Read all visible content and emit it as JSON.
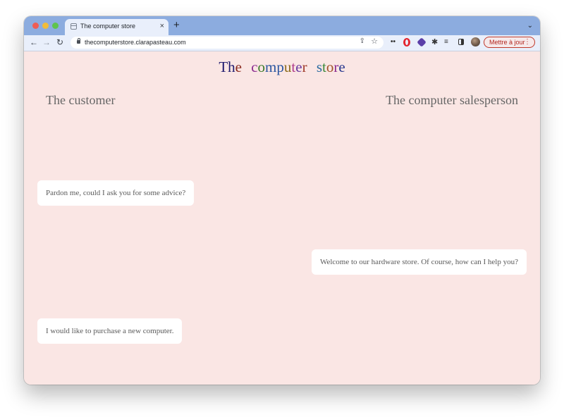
{
  "browser": {
    "tab": {
      "title": "The computer store",
      "close_glyph": "×"
    },
    "new_tab_glyph": "+",
    "tab_menu_glyph": "⌄",
    "address": {
      "url": "thecomputerstore.clarapasteau.com"
    },
    "update_button": {
      "label": "Mettre à jour",
      "menu_glyph": "⋮"
    },
    "icons": {
      "back": "arrow-left-icon",
      "forward": "arrow-right-icon",
      "reload": "reload-icon",
      "lock": "lock-icon",
      "share": "share-icon",
      "bookmark": "star-icon",
      "extensions": [
        "dots-extension-icon",
        "opera-icon",
        "cube-extension-icon",
        "puzzle-icon",
        "reading-list-icon",
        "side-panel-icon"
      ],
      "profile": "avatar"
    }
  },
  "page": {
    "title_words": [
      {
        "text": "The",
        "colors": [
          "#1f1a6e",
          "#1f1a6e",
          "#8a2a1f"
        ]
      },
      {
        "text": "computer",
        "colors": [
          "#8a2a8f",
          "#3c7a2a",
          "#2a55a0",
          "#2a55a0",
          "#8a6a1a",
          "#b03a8a",
          "#6a3aa0",
          "#a03a2a"
        ]
      },
      {
        "text": "store",
        "colors": [
          "#2a6aa0",
          "#3c8a3a",
          "#a0522a",
          "#8a2a8f",
          "#2a3a8f"
        ]
      }
    ],
    "customer_heading": "The customer",
    "salesperson_heading": "The computer salesperson",
    "messages": [
      {
        "speaker": "customer",
        "text": "Pardon me, could I ask you for some advice?"
      },
      {
        "speaker": "salesperson",
        "text": "Welcome to our hardware store. Of course, how can I help you?"
      },
      {
        "speaker": "customer",
        "text": "I would like to purchase a new computer."
      }
    ],
    "colors": {
      "background": "#fae6e4",
      "bubble": "#ffffff",
      "heading_text": "#666666"
    }
  }
}
